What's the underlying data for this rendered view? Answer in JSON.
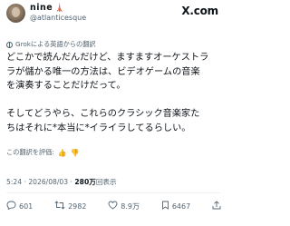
{
  "header": {
    "display_name": "nine",
    "name_emoji": "🗼",
    "handle": "@atlanticesque",
    "logo": "X.com"
  },
  "translation": {
    "notice": "Grokによる英語からの翻訳",
    "icon": "translate-icon"
  },
  "tweet": {
    "lines": [
      "どこかで読んだんだけど、ますますオーケストラ",
      "ラが儲かる唯一の方法は、ビデオゲームの音楽",
      "を演奏することだけだって。",
      "",
      "そしてどうやら、これらのクラシック音楽家た",
      "ちはそれに*本当に*イライラしてるらしい。"
    ]
  },
  "rating": {
    "label": "この翻訳を評価:",
    "up": "👍",
    "down": "👎"
  },
  "meta": {
    "time": "5:24",
    "sep1": "·",
    "date": "2026/08/03",
    "sep2": "·",
    "views": "280万",
    "views_label": "回表示"
  },
  "actions": {
    "replies": "601",
    "reposts": "2982",
    "likes": "8.9万",
    "bookmarks": "6467"
  }
}
